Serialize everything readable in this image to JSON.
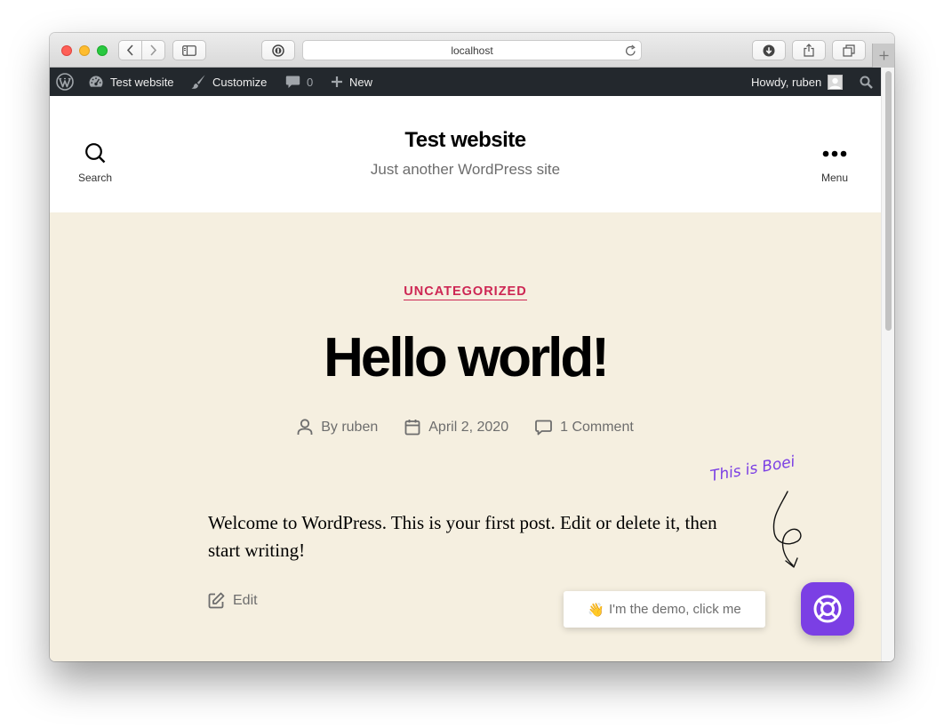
{
  "browser": {
    "url": "localhost"
  },
  "adminbar": {
    "site_name": "Test website",
    "customize": "Customize",
    "comments_count": "0",
    "new": "New",
    "howdy": "Howdy, ruben"
  },
  "header": {
    "search_label": "Search",
    "site_title": "Test website",
    "tagline": "Just another WordPress site",
    "menu_label": "Menu"
  },
  "post": {
    "category": "UNCATEGORIZED",
    "title": "Hello world!",
    "author": "By ruben",
    "date": "April 2, 2020",
    "comments": "1 Comment",
    "body": "Welcome to WordPress. This is your first post. Edit or delete it, then start writing!",
    "edit": "Edit"
  },
  "widget": {
    "note": "This is Boei",
    "emoji": "👋",
    "bubble_text": "I'm the demo, click me",
    "accent": "#7b3fe4"
  },
  "colors": {
    "category": "#cd2653",
    "content_bg": "#f5efe0",
    "adminbar_bg": "#23282d"
  }
}
